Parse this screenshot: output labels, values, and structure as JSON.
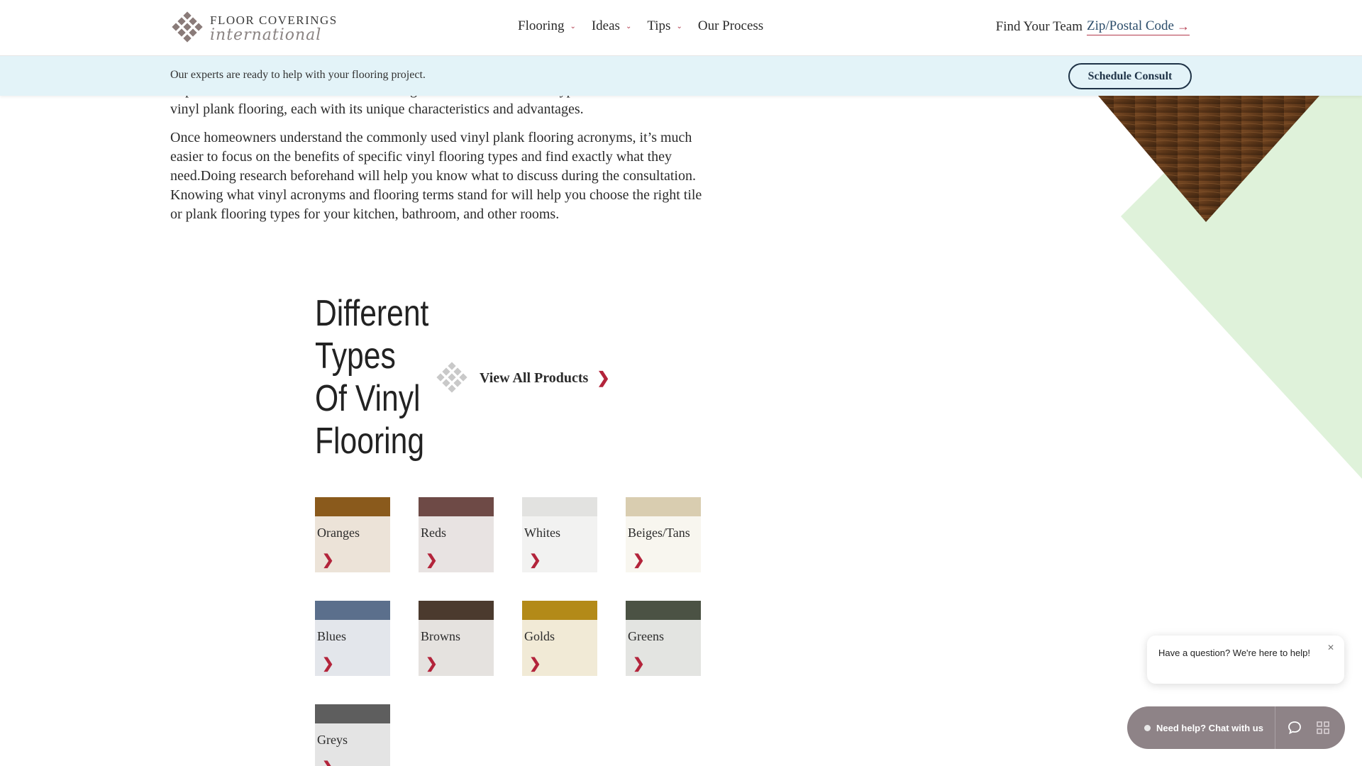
{
  "header": {
    "logo_line1": "FLOOR COVERINGS",
    "logo_line2": "international",
    "nav": [
      {
        "label": "Flooring",
        "has_dropdown": true
      },
      {
        "label": "Ideas",
        "has_dropdown": true
      },
      {
        "label": "Tips",
        "has_dropdown": true
      },
      {
        "label": "Our Process",
        "has_dropdown": false
      }
    ],
    "find_team_label": "Find Your Team",
    "zip_link": "Zip/Postal Code",
    "accent_color": "#b3243b"
  },
  "banner": {
    "text": "Our experts are ready to help with your flooring project.",
    "button": "Schedule Consult",
    "background": "#e3f3f8"
  },
  "article": {
    "clipped_line": "improvement's result from inevitable changes across three different types of",
    "para1_end": "vinyl plank flooring, each with its unique characteristics and advantages.",
    "para2": "Once homeowners understand the commonly used vinyl plank flooring acronyms, it’s much easier to focus on the benefits of specific vinyl flooring types and find exactly what they need.Doing research beforehand will help you know what to discuss during the consultation. Knowing what vinyl acronyms and flooring terms stand for will help you choose the right tile or plank flooring types for your kitchen, bathroom, and other rooms."
  },
  "section": {
    "title_lines": [
      "Different",
      "Types",
      "Of Vinyl",
      "Flooring"
    ],
    "view_all": "View All Products"
  },
  "tiles": [
    {
      "label": "Oranges",
      "top_color": "#8a5a1c",
      "bg_color": "#ece3d8"
    },
    {
      "label": "Reds",
      "top_color": "#6e4a46",
      "bg_color": "#e8e3e2"
    },
    {
      "label": "Whites",
      "top_color": "#e2e2e0",
      "bg_color": "#f2f2f1"
    },
    {
      "label": "Beiges/Tans",
      "top_color": "#d9cdb0",
      "bg_color": "#f8f6ef"
    },
    {
      "label": "Blues",
      "top_color": "#5b6f8c",
      "bg_color": "#e3e6eb"
    },
    {
      "label": "Browns",
      "top_color": "#4b3a2e",
      "bg_color": "#e5e2df"
    },
    {
      "label": "Golds",
      "top_color": "#b38a18",
      "bg_color": "#f1ead6"
    },
    {
      "label": "Greens",
      "top_color": "#4b5244",
      "bg_color": "#e3e4e1"
    },
    {
      "label": "Greys",
      "top_color": "#5e5e5e",
      "bg_color": "#e4e4e4"
    }
  ],
  "chat": {
    "bubble_text": "Have a question? We're here to help!",
    "close_icon": "close-icon",
    "bar_label": "Need help? Chat with us",
    "bar_color": "#8e8387"
  }
}
